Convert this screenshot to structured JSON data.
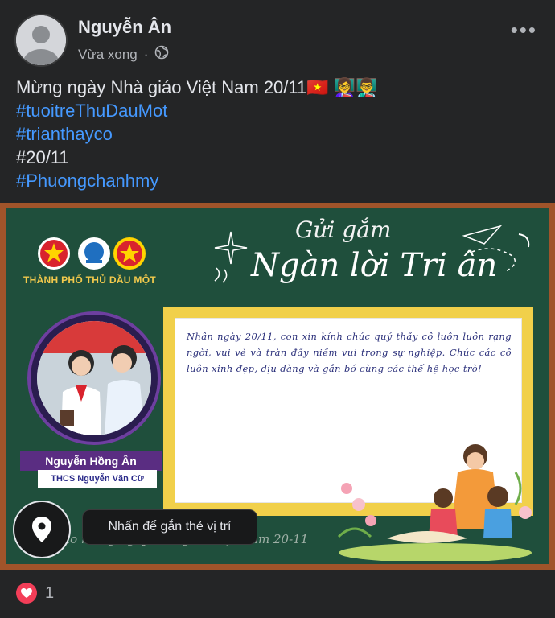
{
  "post": {
    "author": "Nguyễn Ân",
    "timestamp": "Vừa xong",
    "privacy_icon": "globe-icon",
    "more_label": "•••",
    "text_lines": [
      {
        "text": "Mừng ngày Nhà giáo Việt Nam 20/11🇻🇳 👩‍🏫👨‍🏫",
        "type": "plain"
      },
      {
        "text": "#tuoitreThuDauMot",
        "type": "hashtag"
      },
      {
        "text": "#trianthayco",
        "type": "hashtag"
      },
      {
        "text": "#20/11",
        "type": "plain"
      },
      {
        "text": "#Phuongchanhmy",
        "type": "hashtag"
      }
    ]
  },
  "card": {
    "org_name": "THÀNH PHỐ THỦ DẦU MỘT",
    "title_small": "Gửi gắm",
    "title_big": "Ngàn lời Tri ân",
    "student_name": "Nguyễn Hồng Ân",
    "school": "THCS Nguyễn Văn Cừ",
    "message": "Nhân ngày 20/11, con xin kính chúc quý thầy cô luôn luôn rạng ngời, vui vẻ và tràn đầy niềm vui trong sự nghiệp. Chúc các cô luôn xinh đẹp, dịu dàng và gắn bó cùng các thế hệ học trò!",
    "slogan": "Chào mừng ngày Nhà giáo Việt Nam 20-11"
  },
  "location_tag": {
    "icon": "map-pin-icon",
    "tooltip": "Nhấn để gắn thẻ vị trí"
  },
  "reactions": {
    "icon": "heart-icon",
    "count": "1"
  },
  "colors": {
    "background": "#242526",
    "hashtag": "#4599ff",
    "board": "#1f4f3c",
    "frame": "#f1d04a",
    "heart": "#f33e58"
  }
}
